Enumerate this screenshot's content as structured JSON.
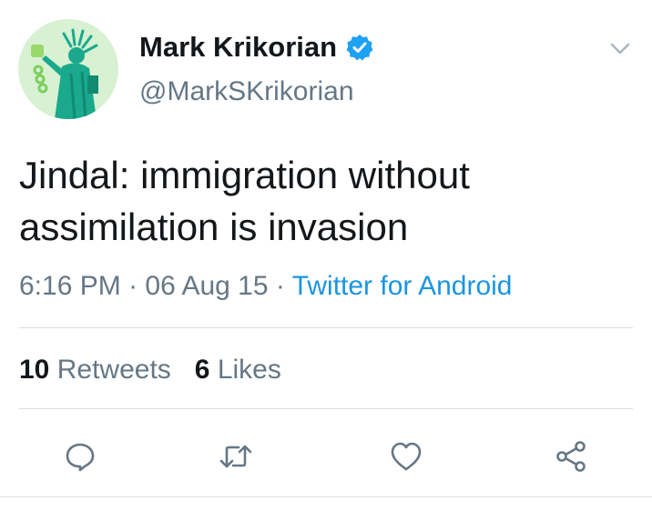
{
  "tweet": {
    "author": {
      "display_name": "Mark Krikorian",
      "handle": "@MarkSKrikorian",
      "verified": true,
      "avatar": "statue-of-liberty"
    },
    "text_lines": [
      "Jindal: immigration without",
      "assimilation is invasion"
    ],
    "meta": {
      "time": "6:16 PM",
      "separator": "·",
      "date": "06 Aug 15",
      "source": "Twitter for Android"
    },
    "stats": {
      "retweets_count": "10",
      "retweets_label": "Retweets",
      "likes_count": "6",
      "likes_label": "Likes"
    },
    "actions": [
      "reply-icon",
      "retweet-icon",
      "like-icon",
      "share-icon"
    ]
  },
  "colors": {
    "text": "#14171a",
    "secondary": "#657786",
    "link": "#1b95e0",
    "verified": "#1da1f2",
    "divider": "#d8dde1",
    "avatar_bg": "#d7f1d2",
    "avatar_figure": "#1aa98c"
  }
}
